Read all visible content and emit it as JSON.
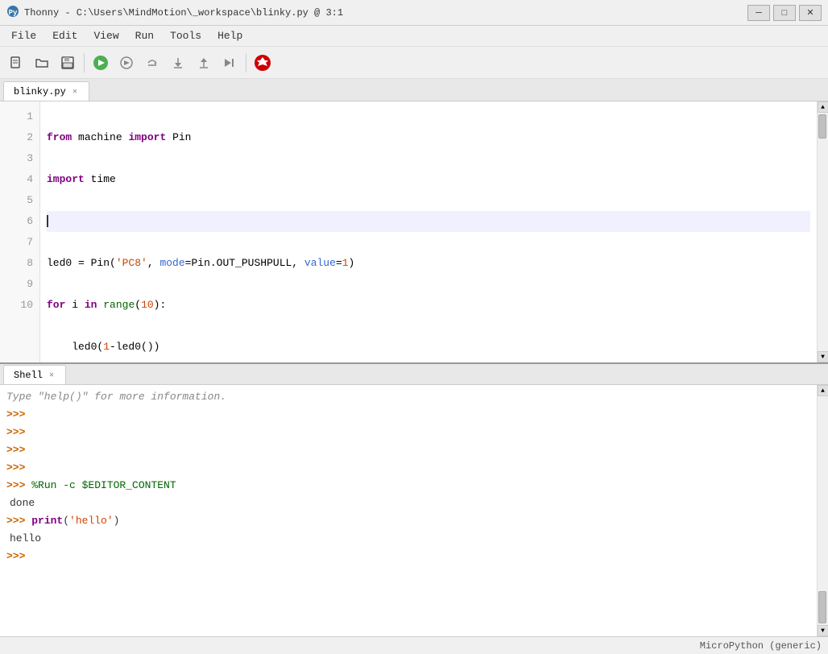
{
  "titlebar": {
    "title": "Thonny - C:\\Users\\MindMotion\\_workspace\\blinky.py @ 3:1",
    "icon": "🐍"
  },
  "titlebar_controls": {
    "minimize": "─",
    "maximize": "□",
    "close": "✕"
  },
  "menu": {
    "items": [
      "File",
      "Edit",
      "View",
      "Run",
      "Tools",
      "Help"
    ]
  },
  "tab": {
    "label": "blinky.py",
    "close": "✕"
  },
  "code": {
    "lines": [
      "1",
      "2",
      "3",
      "4",
      "5",
      "6",
      "7",
      "8",
      "9",
      "10"
    ]
  },
  "shell": {
    "tab_label": "Shell",
    "tab_close": "✕",
    "info_text": "Type \"help()\" for more information.",
    "run_command": "%Run -c $EDITOR_CONTENT",
    "output_done": "done",
    "print_cmd": "print('hello')",
    "output_hello": "hello"
  },
  "statusbar": {
    "interpreter": "MicroPython (generic)"
  }
}
